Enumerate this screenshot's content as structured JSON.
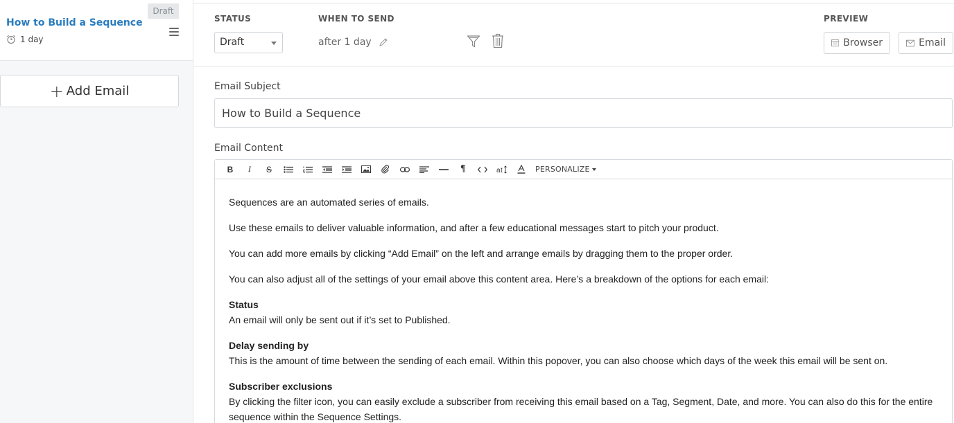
{
  "sidebar": {
    "card": {
      "badge": "Draft",
      "title": "How to Build a Sequence",
      "delay": "1 day"
    },
    "add_email_label": "Add Email"
  },
  "settings": {
    "status_label": "STATUS",
    "status_value": "Draft",
    "when_label": "WHEN TO SEND",
    "when_value": "after 1 day",
    "preview_label": "PREVIEW",
    "browser_btn": "Browser",
    "email_btn": "Email"
  },
  "subject": {
    "label": "Email Subject",
    "value": "How to Build a Sequence"
  },
  "editor": {
    "label": "Email Content",
    "personalize": "PERSONALIZE",
    "paragraphs": [
      "Sequences are an automated series of emails.",
      "Use these emails to deliver valuable information, and after a few educational messages start to pitch your product.",
      "You can add more emails by clicking “Add Email” on the left and arrange emails by dragging them to the proper order.",
      "You can also adjust all of the settings of your email above this content area. Here’s a breakdown of the options for each email:"
    ],
    "sections": [
      {
        "heading": "Status",
        "text": "An email will only be sent out if it’s set to Published."
      },
      {
        "heading": "Delay sending by",
        "text": "This is the amount of time between the sending of each email. Within this popover, you can also choose which days of the week this email will be sent on."
      },
      {
        "heading": "Subscriber exclusions",
        "text": "By clicking the filter icon, you can easily exclude a subscriber from receiving this email based on a Tag, Segment, Date, and more. You can also do this for the entire sequence within the Sequence Settings."
      }
    ]
  }
}
